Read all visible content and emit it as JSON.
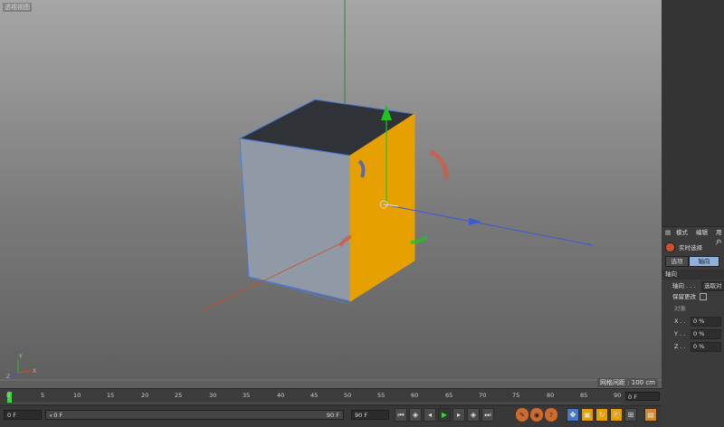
{
  "viewport": {
    "title": "透视视图",
    "grid_info": "网格间距 : 100 cm",
    "axis_labels": [
      "Y",
      "X",
      "Z"
    ]
  },
  "attributes": {
    "menu": [
      "模式",
      "编辑",
      "用户"
    ],
    "live_select": "实时选择",
    "tabs": [
      "选项",
      "轴向"
    ],
    "active_tab": "轴向",
    "section_title": "轴向",
    "axis_label": "轴向 . . .",
    "axis_value": "选取对象",
    "keep_changes": "保留更改",
    "object_label": "对象",
    "coords": [
      {
        "label": "X . .",
        "value": "0 %"
      },
      {
        "label": "Y . .",
        "value": "0 %"
      },
      {
        "label": "Z . .",
        "value": "0 %"
      }
    ]
  },
  "timeline": {
    "ticks": [
      "0",
      "5",
      "10",
      "15",
      "20",
      "25",
      "30",
      "35",
      "40",
      "45",
      "50",
      "55",
      "60",
      "65",
      "70",
      "75",
      "80",
      "85",
      "90"
    ],
    "current_frame": "0 F"
  },
  "transport": {
    "start": "0 F",
    "range_start": "0 F",
    "range_end": "90 F",
    "end": "90 F",
    "colors": {
      "accent": "#e6a000",
      "play": "#3fd13f",
      "active_tool": "#4a78c8"
    }
  }
}
